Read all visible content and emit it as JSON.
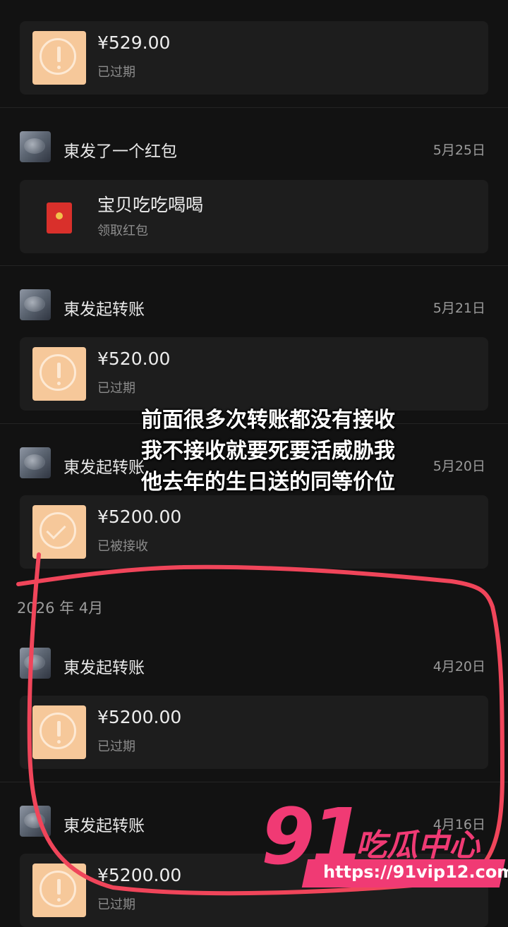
{
  "entries": [
    {
      "amount": "¥529.00",
      "status": "已过期"
    },
    {
      "title": "東发了一个红包",
      "date": "5月25日",
      "packet_title": "宝贝吃吃喝喝",
      "packet_sub": "领取红包"
    },
    {
      "title": "東发起转账",
      "date": "5月21日",
      "amount": "¥520.00",
      "status": "已过期"
    },
    {
      "title": "東发起转账",
      "date": "5月20日",
      "amount": "¥5200.00",
      "status": "已被接收"
    },
    {
      "title": "東发起转账",
      "date": "4月20日",
      "amount": "¥5200.00",
      "status": "已过期"
    },
    {
      "title": "東发起转账",
      "date": "4月16日",
      "amount": "¥5200.00",
      "status": "已过期"
    }
  ],
  "month_header": "2026 年 4月",
  "overlay_lines": [
    "前面很多次转账都没有接收",
    "我不接收就要死要活威胁我",
    "他去年的生日送的同等价位"
  ],
  "watermark": {
    "number": "91",
    "brand": "吃瓜中心",
    "url": "https://91vip12.com"
  },
  "colors": {
    "background": "#121212",
    "card": "#1d1d1d",
    "transfer_icon": "#f6c89a",
    "annotation": "#f0455a",
    "watermark": "#f03a74"
  }
}
